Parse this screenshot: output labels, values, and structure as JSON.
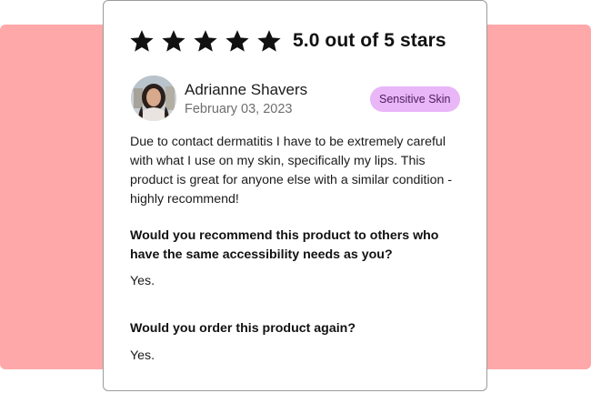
{
  "colors": {
    "background_band": "#fea8a9",
    "card_border": "#9c9c9c",
    "tag_background": "#e9b6f7",
    "tag_text": "#4d2160",
    "star": "#111111"
  },
  "rating": {
    "star_count": 5,
    "filled_stars": 5,
    "star_icon": "star-filled-icon",
    "text": "5.0 out of 5 stars"
  },
  "reviewer": {
    "name": "Adrianne Shavers",
    "date": "February 03, 2023",
    "tag": "Sensitive Skin"
  },
  "review": {
    "body": "Due to contact dermatitis I have to be extremely careful with what I use on my skin, specifically my lips. This product is great for anyone else with a similar condition - highly recommend!"
  },
  "qa": [
    {
      "question": "Would you recommend this product to others who have the same accessibility needs as you?",
      "answer": "Yes."
    },
    {
      "question": "Would you order this product again?",
      "answer": "Yes."
    }
  ]
}
